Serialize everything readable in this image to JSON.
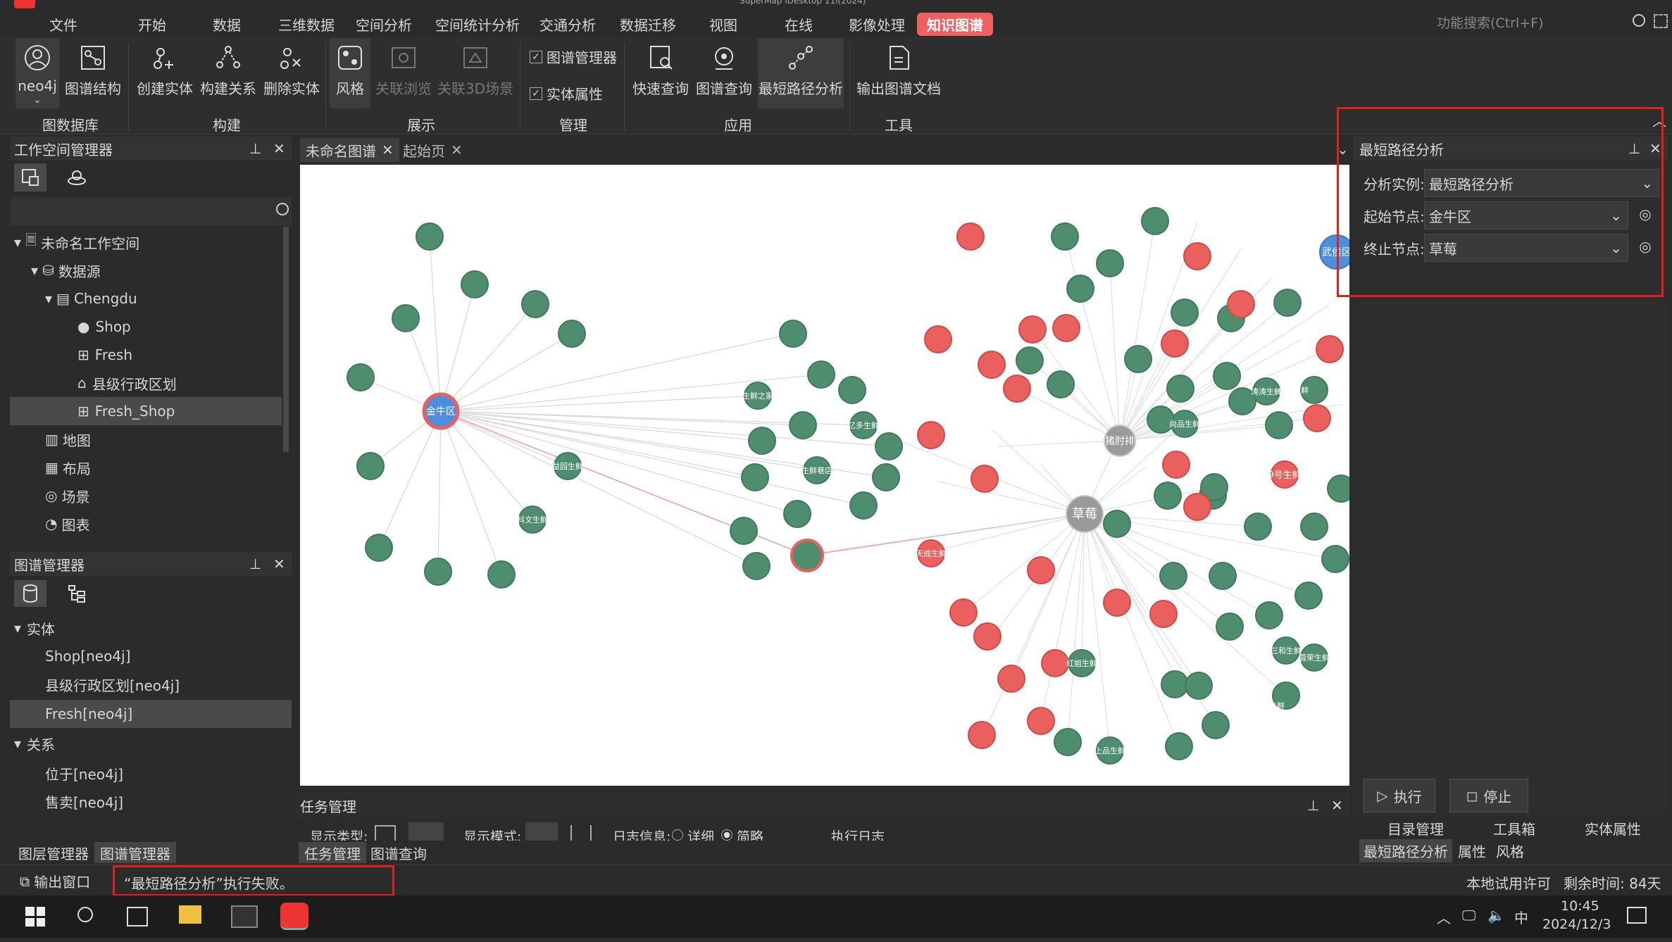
{
  "title_bar": {
    "window_title": "SuperMap iDesktop 11i(2024)"
  },
  "menu": [
    "文件",
    "开始",
    "数据",
    "三维数据",
    "空间分析",
    "空间统计分析",
    "交通分析",
    "数据迁移",
    "视图",
    "在线",
    "影像处理",
    "知识图谱"
  ],
  "search": {
    "placeholder": "功能搜索(Ctrl+F)"
  },
  "ribbon": {
    "groups": {
      "graphdb": "图数据库",
      "build": "构建",
      "display": "展示",
      "manage": "管理",
      "app": "应用",
      "tools": "工具"
    },
    "buttons": {
      "neo4j": "neo4j",
      "graph_structure": "图谱结构",
      "create_entity": "创建实体",
      "build_relation": "构建关系",
      "delete_entity": "删除实体",
      "style": "风格",
      "linked_browse": "关联浏览",
      "linked_3d": "关联3D场景",
      "quick_query": "快速查询",
      "graph_query": "图谱查询",
      "shortest_path": "最短路径分析",
      "export_doc": "输出图谱文档"
    },
    "checks": {
      "graph_manager": "图谱管理器",
      "entity_attr": "实体属性"
    }
  },
  "workspace_panel": {
    "title": "工作空间管理器",
    "tree": {
      "workspace": "未命名工作空间",
      "datasource": "数据源",
      "chengdu": "Chengdu",
      "shop": "Shop",
      "fresh": "Fresh",
      "county": "县级行政区划",
      "fresh_shop": "Fresh_Shop",
      "map": "地图",
      "layout": "布局",
      "scene": "场景",
      "chart": "图表"
    }
  },
  "graph_panel": {
    "title": "图谱管理器",
    "entity": "实体",
    "shop": "Shop[neo4j]",
    "county": "县级行政区划[neo4j]",
    "fresh": "Fresh[neo4j]",
    "relation": "关系",
    "located": "位于[neo4j]",
    "sell": "售卖[neo4j]"
  },
  "bottom_left_tabs": [
    "图层管理器",
    "图谱管理器"
  ],
  "doc_tabs": [
    "未命名图谱",
    "起始页"
  ],
  "graph_view": {
    "nodes": {
      "jinniu": "金牛区",
      "caomei": "草莓",
      "zhuzhou": "猪肘排",
      "wuhou": "武侯区",
      "yidudian": "亿多生鲜",
      "yiwu": "益园生鲜",
      "kewen": "科文生鲜",
      "shengxian_zhijia": "生鲜之家",
      "xianguo": "生鲜巷店",
      "jiuhao": "9号生鲜",
      "shanghao": "尚品生鲜",
      "hongyan": "红姐生鲜",
      "shangpin": "上品生鲜",
      "tiancheng": "天成生鲜",
      "huanyu": "环球生鲜",
      "shuiguo": "涛涛生鲜",
      "sanhe": "三和生鲜",
      "rongren": "蓉荣生鲜",
      "pinyou": "品优生鲜",
      "xiaozhang": "小张生鲜"
    }
  },
  "right_panel": {
    "title": "最短路径分析",
    "instance_label": "分析实例:",
    "instance_value": "最短路径分析",
    "start_label": "起始节点:",
    "start_value": "金牛区",
    "end_label": "终止节点:",
    "end_value": "草莓",
    "execute": "执行",
    "stop": "停止",
    "bottom_tabs_1": [
      "目录管理",
      "工具箱",
      "实体属性"
    ],
    "bottom_tabs_2": [
      "最短路径分析",
      "属性",
      "风格"
    ]
  },
  "task_panel": {
    "title": "任务管理",
    "display_type": "显示类型:",
    "display_mode": "显示模式:",
    "log_info": "日志信息:",
    "detailed": "详细",
    "brief": "简略",
    "exec_log": "执行日志"
  },
  "bottom_tabs": [
    "任务管理",
    "图谱查询"
  ],
  "status": {
    "output_window": "输出窗口",
    "message": "“最短路径分析”执行失败。",
    "license": "本地试用许可",
    "remaining": "剩余时间: 84天"
  },
  "taskbar": {
    "time": "10:45",
    "date": "2024/12/3",
    "ime": "中"
  },
  "colors": {
    "green_node": "#4e8d6e",
    "red_node": "#e9605f",
    "blue_node": "#4d8fdb",
    "gray_node": "#9a9a9a",
    "accent_tab": "#f06060",
    "highlight_box": "#e02020"
  }
}
